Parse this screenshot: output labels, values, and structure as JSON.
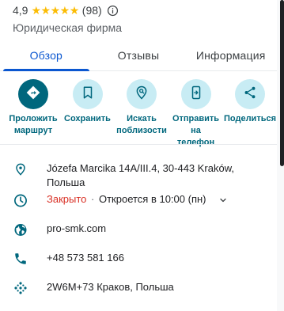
{
  "place": {
    "rating": "4,9",
    "stars": [
      "★",
      "★",
      "★",
      "★",
      "★"
    ],
    "reviews": "(98)",
    "category": "Юридическая фирма"
  },
  "tabs": [
    {
      "label": "Обзор",
      "active": true
    },
    {
      "label": "Отзывы",
      "active": false
    },
    {
      "label": "Информация",
      "active": false
    }
  ],
  "actions": [
    {
      "label": "Проложить маршрут",
      "icon": "directions-icon"
    },
    {
      "label": "Сохранить",
      "icon": "bookmark-icon"
    },
    {
      "label": "Искать поблизости",
      "icon": "nearby-search-icon"
    },
    {
      "label": "Отправить на телефон",
      "icon": "send-to-phone-icon"
    },
    {
      "label": "Поделиться",
      "icon": "share-icon"
    }
  ],
  "details": {
    "address": "Józefa Marcika 14A/III.4, 30-443 Kraków, Польша",
    "hours_status": "Закрыто",
    "hours_sep": "·",
    "hours_next": "Откроется в 10:00 (пн)",
    "website": "pro-smk.com",
    "phone": "+48 573 581 166",
    "plus_code": "2W6M+73 Краков, Польша"
  },
  "colors": {
    "accent": "#00677d",
    "action_bg": "#c8ecf4",
    "tab_active": "#0b57d0",
    "closed": "#d93025",
    "star": "#fbbc04"
  }
}
